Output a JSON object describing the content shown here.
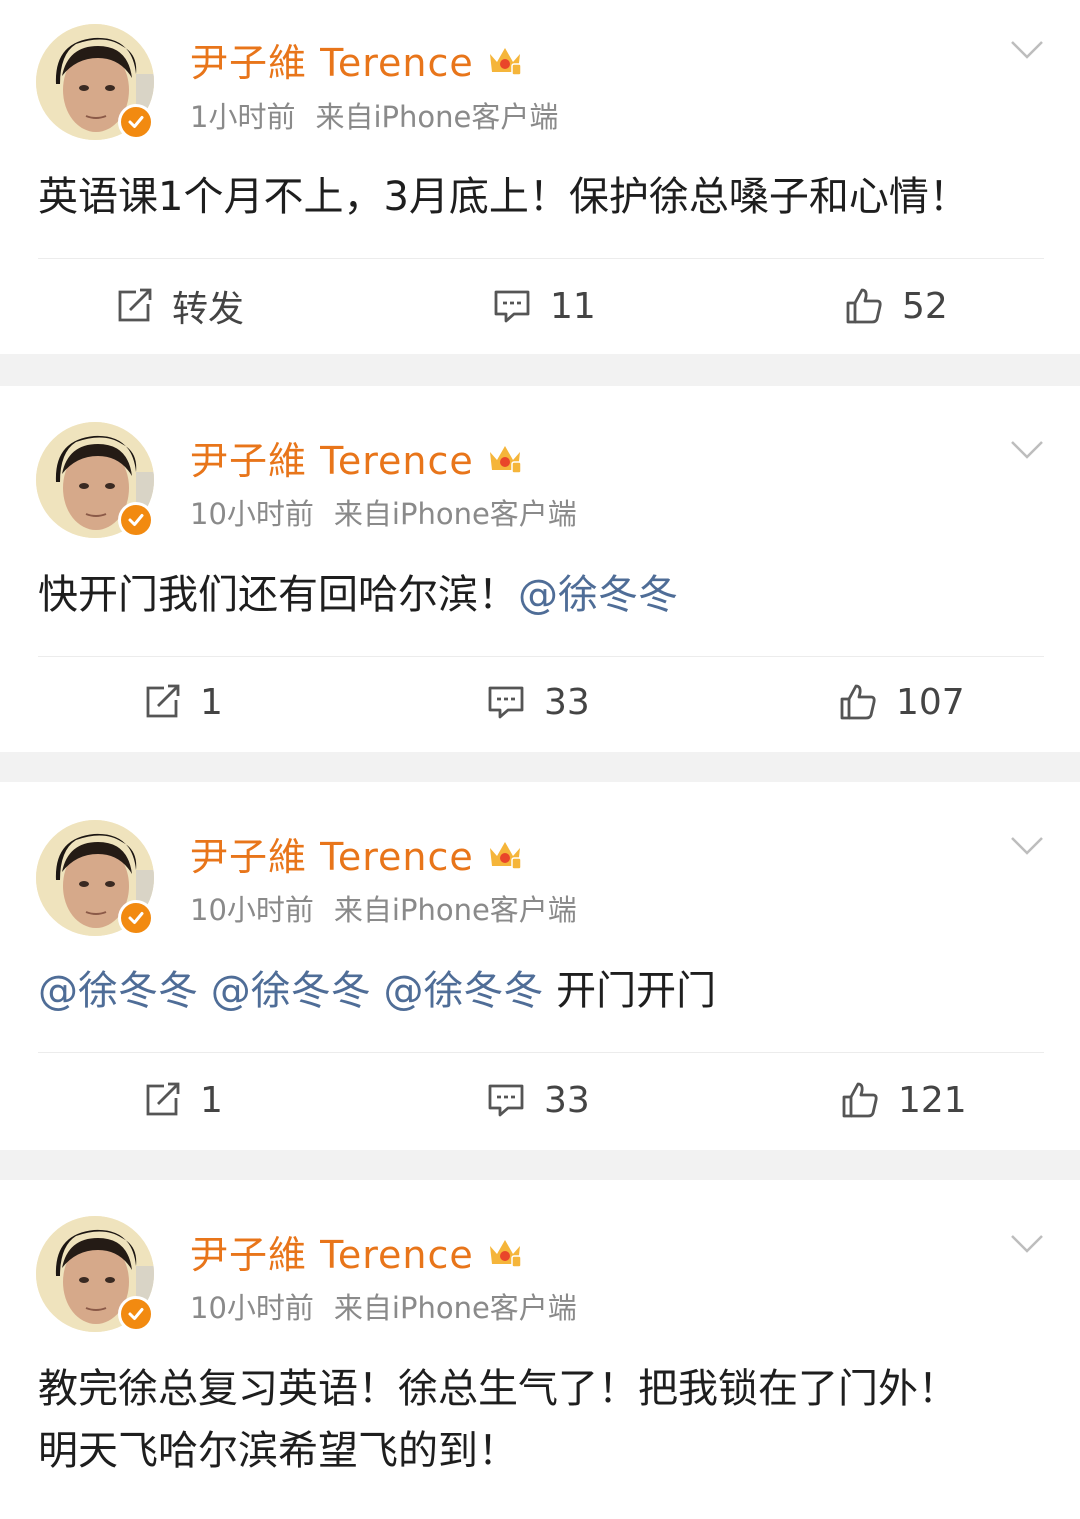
{
  "posts": [
    {
      "username": "尹子維 Terence",
      "time": "1小时前",
      "source": "来自iPhone客户端",
      "lines": [
        [
          {
            "text": "英语课1个月不上，3月底上！保护徐总嗓子和心情！",
            "mention": false
          }
        ]
      ],
      "repost": "转发",
      "comments": "11",
      "likes": "52"
    },
    {
      "username": "尹子維 Terence",
      "time": "10小时前",
      "source": "来自iPhone客户端",
      "lines": [
        [
          {
            "text": "快开门我们还有回哈尔滨！",
            "mention": false
          },
          {
            "text": "@徐冬冬",
            "mention": true
          }
        ]
      ],
      "repost": "1",
      "comments": "33",
      "likes": "107"
    },
    {
      "username": "尹子維 Terence",
      "time": "10小时前",
      "source": "来自iPhone客户端",
      "lines": [
        [
          {
            "text": "@徐冬冬",
            "mention": true
          },
          {
            "text": " ",
            "mention": false
          },
          {
            "text": "@徐冬冬",
            "mention": true
          },
          {
            "text": " ",
            "mention": false
          },
          {
            "text": "@徐冬冬",
            "mention": true
          },
          {
            "text": " 开门开门",
            "mention": false
          }
        ]
      ],
      "repost": "1",
      "comments": "33",
      "likes": "121"
    },
    {
      "username": "尹子維 Terence",
      "time": "10小时前",
      "source": "来自iPhone客户端",
      "lines": [
        [
          {
            "text": "教完徐总复习英语！徐总生气了！把我锁在了门外！",
            "mention": false
          }
        ],
        [
          {
            "text": "明天飞哈尔滨希望飞的到！",
            "mention": false
          }
        ]
      ]
    }
  ],
  "colors": {
    "username": "#e8751a",
    "mention": "#4f6d97",
    "meta": "#8a8a8a",
    "verified_badge": "#f28a10",
    "separator": "#f2f2f2"
  },
  "icons": [
    "avatar",
    "verified-icon",
    "vip-crown-icon",
    "chevron-down-icon",
    "repost-icon",
    "comment-icon",
    "like-icon"
  ]
}
